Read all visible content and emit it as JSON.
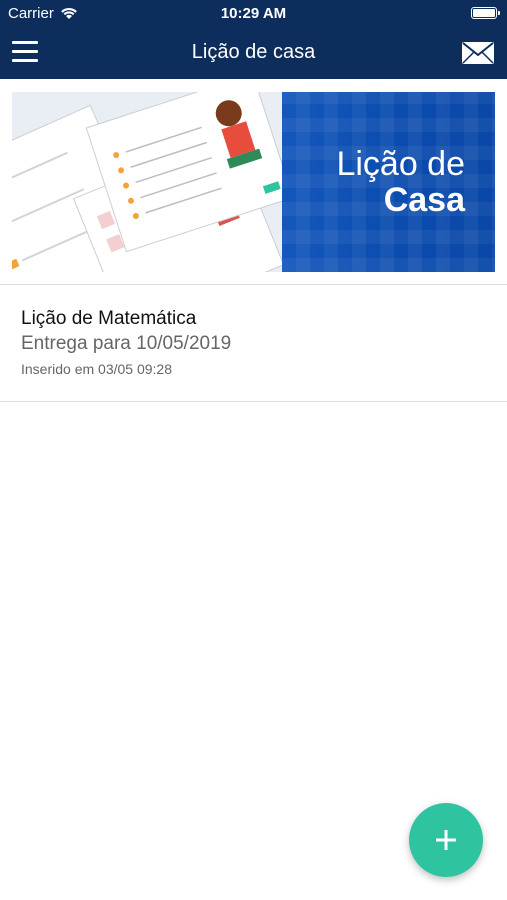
{
  "status_bar": {
    "carrier": "Carrier",
    "time": "10:29 AM",
    "wifi_icon": "wifi-icon",
    "battery_icon": "battery-icon"
  },
  "nav": {
    "title": "Lição de casa",
    "menu_icon": "hamburger-menu-icon",
    "mail_icon": "mail-icon"
  },
  "banner": {
    "line1": "Lição de",
    "line2": "Casa"
  },
  "homework": [
    {
      "title": "Lição de Matemática",
      "due": "Entrega para 10/05/2019",
      "inserted": "Inserido em 03/05 09:28"
    }
  ],
  "fab": {
    "icon": "plus-icon"
  },
  "colors": {
    "nav_background": "#0d2d5c",
    "banner_blue": "#0b4fb3",
    "fab_green": "#2ec4a0"
  }
}
